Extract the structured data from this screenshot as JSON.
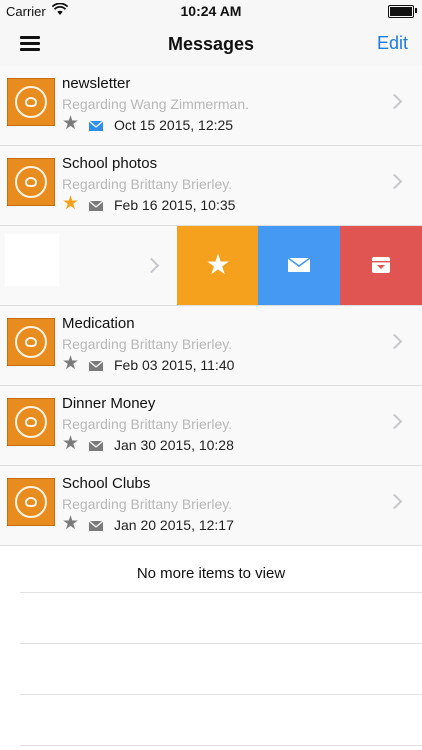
{
  "status_bar": {
    "carrier": "Carrier",
    "time": "10:24 AM"
  },
  "nav": {
    "title": "Messages",
    "edit_label": "Edit"
  },
  "messages": [
    {
      "subject": "newsletter",
      "regarding": "Regarding Wang Zimmerman.",
      "date": "Oct 15 2015, 12:25",
      "starred": false,
      "unread": true
    },
    {
      "subject": "School photos",
      "regarding": "Regarding Brittany Brierley.",
      "date": "Feb 16 2015, 10:35",
      "starred": true,
      "unread": false
    },
    {
      "subject": "Medication",
      "regarding": "Regarding Brittany Brierley.",
      "date": "Feb 03 2015, 11:40",
      "starred": false,
      "unread": false
    },
    {
      "subject": "Dinner Money",
      "regarding": "Regarding Brittany Brierley.",
      "date": "Jan 30 2015, 10:28",
      "starred": false,
      "unread": false
    },
    {
      "subject": "School Clubs",
      "regarding": "Regarding Brittany Brierley.",
      "date": "Jan 20 2015, 12:17",
      "starred": false,
      "unread": false
    }
  ],
  "swipe_actions": {
    "star_icon": "star-icon",
    "mail_icon": "envelope-icon",
    "archive_icon": "archive-icon",
    "colors": {
      "star": "#f5a11d",
      "mail": "#4699f2",
      "archive": "#e05452"
    }
  },
  "colors": {
    "accent": "#1a7ddb",
    "star_active": "#f5a11d",
    "star_inactive": "#7a7a7a",
    "envelope_unread": "#2f8fe8",
    "envelope_read": "#7a7a7a"
  },
  "footer": {
    "no_more": "No more items to view"
  }
}
